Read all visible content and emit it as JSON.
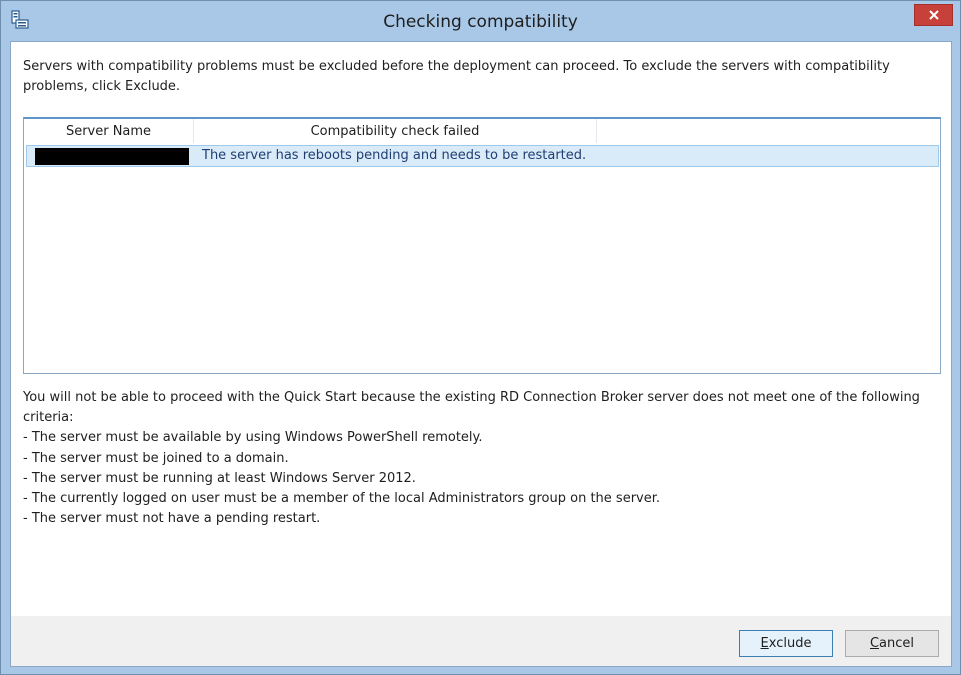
{
  "window": {
    "title": "Checking compatibility"
  },
  "intro": {
    "text": "Servers with compatibility problems must be excluded before the deployment can proceed. To exclude the servers with compatibility problems, click Exclude."
  },
  "table": {
    "columns": [
      "Server Name",
      "Compatibility check failed"
    ],
    "rows": [
      {
        "server_name": "[redacted]",
        "failure": "The server has reboots pending and needs to be restarted."
      }
    ]
  },
  "criteria": {
    "lead": "You will not be able to proceed with the Quick Start because the existing RD Connection Broker server does not meet one of the following criteria:",
    "items": [
      "- The server must be available by using Windows PowerShell remotely.",
      "- The server must be joined to a domain.",
      "- The server must be running at least Windows Server 2012.",
      "- The currently logged on user must be a member of the local Administrators group on the server.",
      "- The server must not have a pending restart."
    ]
  },
  "buttons": {
    "exclude_first": "E",
    "exclude_rest": "xclude",
    "cancel_first": "C",
    "cancel_rest": "ancel"
  },
  "icons": {
    "app": "server-manager-icon",
    "close": "close-icon"
  },
  "colors": {
    "titlebar": "#a9c8e8",
    "close": "#c7413a",
    "selected_row": "#d9ebf9",
    "row_text": "#1f3e73"
  }
}
